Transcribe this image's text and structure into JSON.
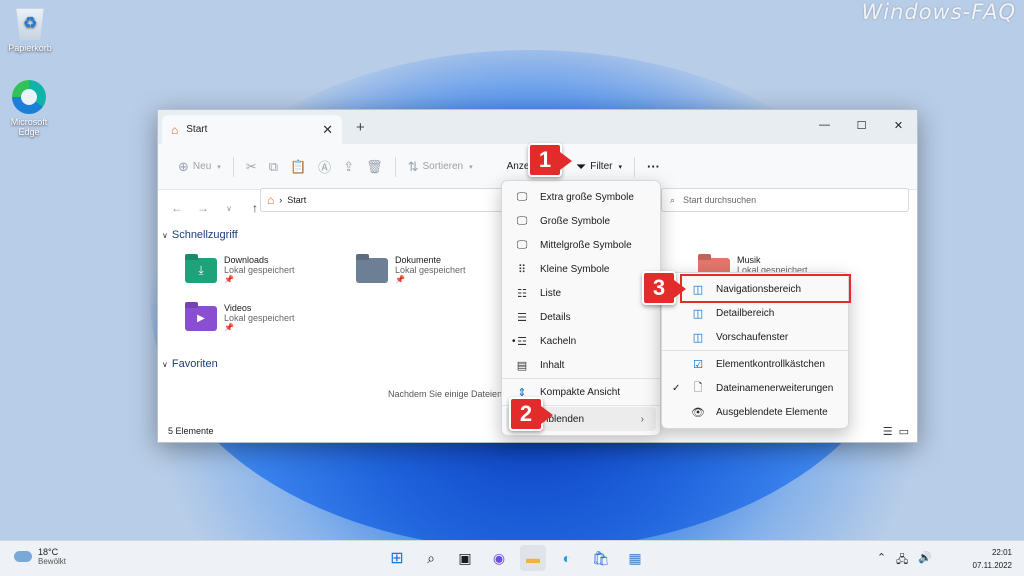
{
  "watermark": "Windows-FAQ",
  "desktop": {
    "recycle_bin": "Papierkorb",
    "edge": "Microsoft Edge"
  },
  "window": {
    "tab_title": "Start",
    "close_tab": "✕",
    "new_tab": "+",
    "minimize": "—",
    "maximize": "☐",
    "close": "✕"
  },
  "toolbar": {
    "new_label": "Neu",
    "sort_label": "Sortieren",
    "view_label": "Anzeigen",
    "filter_label": "Filter",
    "more_label": "···"
  },
  "address": {
    "path": "Start",
    "search_placeholder": "Start durchsuchen"
  },
  "content": {
    "quick_access": "Schnellzugriff",
    "favorites": "Favoriten",
    "favorites_hint": "Nachdem Sie einige Dateien",
    "items": [
      {
        "name": "Downloads",
        "sub": "Lokal gespeichert",
        "color": "#1fa27a"
      },
      {
        "name": "Dokumente",
        "sub": "Lokal gespeichert",
        "color": "#6d7f95"
      },
      {
        "name": "Musik",
        "sub": "Lokal gespeichert",
        "color": "#e0776b"
      },
      {
        "name": "Videos",
        "sub": "Lokal gespeichert",
        "color": "#8a4fd0"
      }
    ],
    "status": "5 Elemente"
  },
  "view_menu": {
    "items": [
      {
        "label": "Extra große Symbole",
        "icon": "monitor-icon"
      },
      {
        "label": "Große Symbole",
        "icon": "monitor-icon"
      },
      {
        "label": "Mittelgroße Symbole",
        "icon": "monitor-icon"
      },
      {
        "label": "Kleine Symbole",
        "icon": "grid-icon"
      },
      {
        "label": "Liste",
        "icon": "list-icon"
      },
      {
        "label": "Details",
        "icon": "details-icon"
      },
      {
        "label": "Kacheln",
        "icon": "tiles-icon",
        "checked": true
      },
      {
        "label": "Inhalt",
        "icon": "content-icon"
      },
      {
        "label": "Kompakte Ansicht",
        "icon": "compact-icon"
      },
      {
        "label": "Einblenden",
        "icon": "",
        "submenu": true
      }
    ]
  },
  "show_menu": {
    "items": [
      {
        "label": "Navigationsbereich",
        "icon": "panel-left-icon"
      },
      {
        "label": "Detailbereich",
        "icon": "panel-right-icon"
      },
      {
        "label": "Vorschaufenster",
        "icon": "panel-right-icon"
      },
      {
        "label": "Elementkontrollkästchen",
        "icon": "checkbox-icon"
      },
      {
        "label": "Dateinamenerweiterungen",
        "icon": "file-icon",
        "checked": true
      },
      {
        "label": "Ausgeblendete Elemente",
        "icon": "eye-icon"
      }
    ]
  },
  "badges": [
    "1",
    "2",
    "3"
  ],
  "taskbar": {
    "temperature": "18°C",
    "weather": "Bewölkt",
    "time": "22:01",
    "date": "07.11.2022"
  },
  "colors": {
    "accent": "#0067c0",
    "badge": "#e22b2b"
  }
}
